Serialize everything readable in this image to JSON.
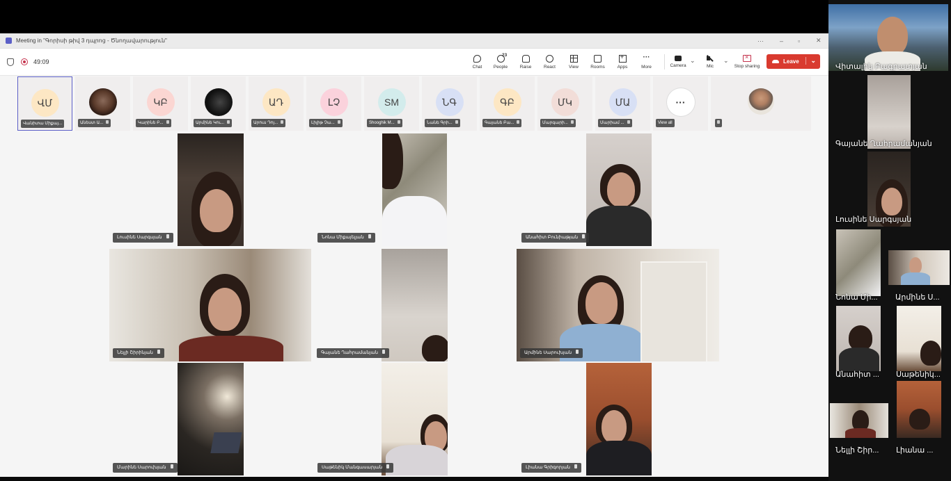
{
  "window": {
    "title": "Meeting in \"Գորիսի թիվ 3 դպրոց - Ծնողավարություն\"",
    "controls": [
      "···",
      "–",
      "▫",
      "✕"
    ]
  },
  "meeting": {
    "timer": "49:09"
  },
  "toolbar": {
    "chat": "Chat",
    "people": "People",
    "people_count": "23",
    "raise": "Raise",
    "react": "React",
    "view": "View",
    "rooms": "Rooms",
    "apps": "Apps",
    "more": "More",
    "camera": "Camera",
    "mic": "Mic",
    "stop_sharing": "Stop sharing",
    "leave": "Leave"
  },
  "participants_strip": [
    {
      "initials": "ՎՄ",
      "name": "Վանիտա Միքայ...",
      "color": "#fde7c4"
    },
    {
      "initials": "",
      "name": "Անեստ Ա...",
      "color": ""
    },
    {
      "initials": "ԿԲ",
      "name": "Կարինե Բ...",
      "color": "#fbd6d2"
    },
    {
      "initials": "",
      "name": "Արմինե Կու...",
      "color": ""
    },
    {
      "initials": "ԱԴ",
      "name": "Արուս Դոյ...",
      "color": "#fde7c4"
    },
    {
      "initials": "ԼՉ",
      "name": "Լիլիթ Չա...",
      "color": "#fbd2dc"
    },
    {
      "initials": "SM",
      "name": "Shooghik M...",
      "color": "#d3ecec"
    },
    {
      "initials": "ՆԳ",
      "name": "Նանե Գրի...",
      "color": "#d8e0f5"
    },
    {
      "initials": "ԳԲ",
      "name": "Գայանե Բա...",
      "color": "#fde7c4"
    },
    {
      "initials": "ՄԿ",
      "name": "Մարգարի...",
      "color": "#f2ddd8"
    },
    {
      "initials": "ՄԱ",
      "name": "Մարիամ ...",
      "color": "#d8e0f5"
    },
    {
      "initials": "···",
      "name": "View all",
      "color": "#ffffff"
    },
    {
      "initials": "",
      "name": "",
      "color": ""
    }
  ],
  "video_grid": [
    {
      "name": "Լուսինե Սարգսյան"
    },
    {
      "name": "Նոնա Միքայելյան"
    },
    {
      "name": "Անահիտ Բունիաթյան"
    },
    {
      "name": "Նելլի Շիրինյան"
    },
    {
      "name": "Գայանե Ղահրամանյան"
    },
    {
      "name": "Արմինե Սարուխյան"
    },
    {
      "name": "Մարինե Սարուխյան"
    },
    {
      "name": "Սաթենիկ Մանգասարյան"
    },
    {
      "name": "Լիանա Գրիգորյան"
    }
  ],
  "sidebar": [
    {
      "name": "Վիտալիկ Բագրատյան"
    },
    {
      "name": "Գայանե Ղահրամանյան"
    },
    {
      "name": "Լուսինե Սարգսյան"
    },
    {
      "name": "Նոնա Մի..."
    },
    {
      "name": "Արմինե Ս..."
    },
    {
      "name": "Անահիտ ..."
    },
    {
      "name": "Սաթենիկ..."
    },
    {
      "name": "Նելլի Շիր..."
    },
    {
      "name": "Լիանա ..."
    }
  ]
}
